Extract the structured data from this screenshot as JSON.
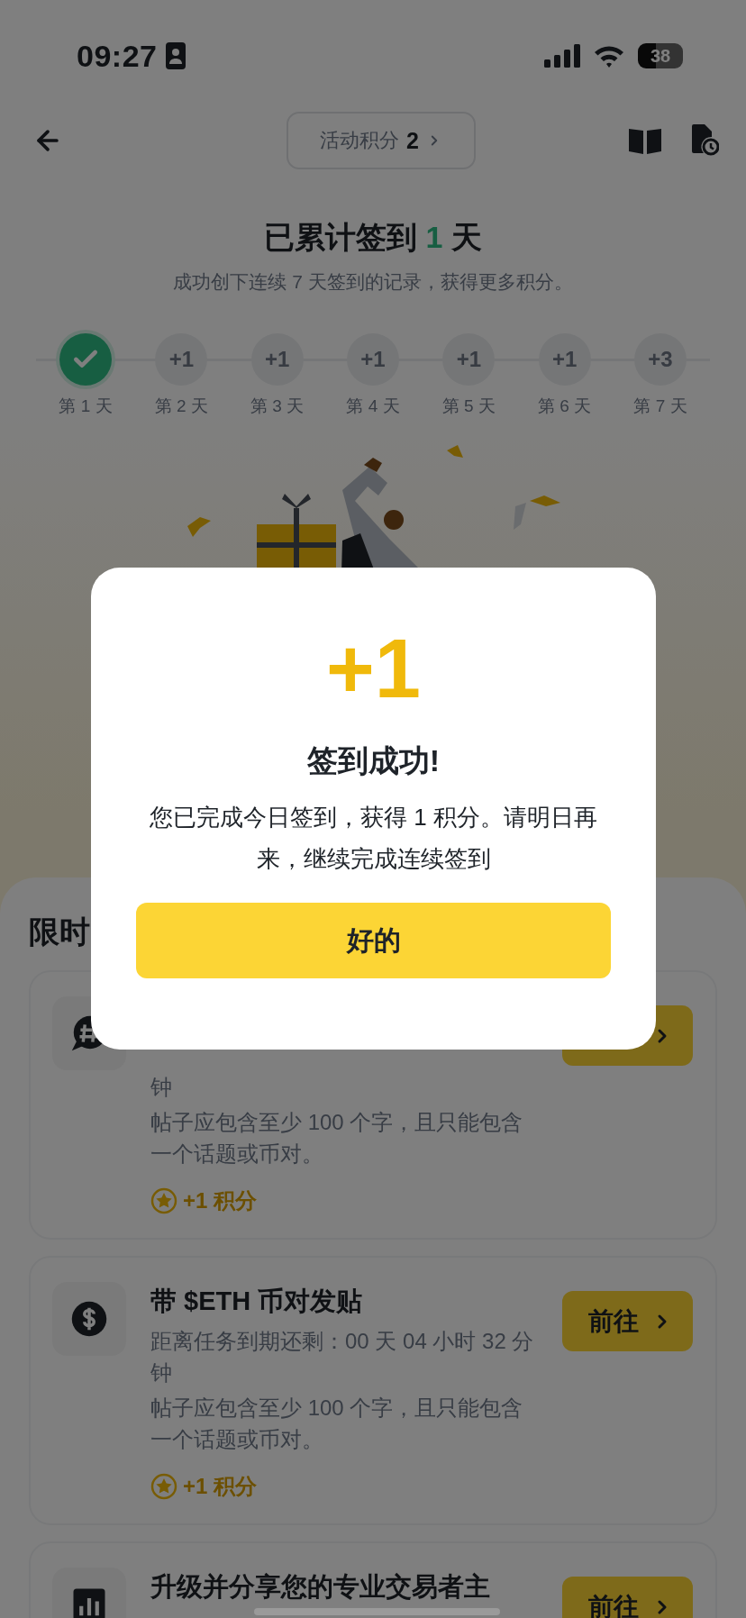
{
  "status_bar": {
    "time": "09:27",
    "battery": "38"
  },
  "header": {
    "points_label": "活动积分",
    "points_value": "2"
  },
  "streak": {
    "before": "已累计签到 ",
    "count": "1",
    "after": " 天",
    "subtitle": "成功创下连续 7 天签到的记录，获得更多积分。"
  },
  "steps": [
    {
      "label": "第 1 天",
      "done": true
    },
    {
      "label": "第 2 天",
      "done": false,
      "reward": "+1"
    },
    {
      "label": "第 3 天",
      "done": false,
      "reward": "+1"
    },
    {
      "label": "第 4 天",
      "done": false,
      "reward": "+1"
    },
    {
      "label": "第 5 天",
      "done": false,
      "reward": "+1"
    },
    {
      "label": "第 6 天",
      "done": false,
      "reward": "+1"
    },
    {
      "label": "第 7 天",
      "done": false,
      "reward": "+3"
    }
  ],
  "tasks_section": {
    "title": "限时"
  },
  "tasks": [
    {
      "kind": "hashtag",
      "countdown": "钟",
      "rule": "帖子应包含至少 100 个字，且只能包含一个话题或币对。",
      "reward": "+1 积分"
    },
    {
      "kind": "dollar",
      "title": "带 $ETH 币对发贴",
      "button": "前往",
      "countdown": "距离任务到期还剩：00 天 04 小时 32 分钟",
      "rule": "帖子应包含至少 100 个字，且只能包含一个话题或币对。",
      "reward": "+1 积分"
    },
    {
      "kind": "chart",
      "title": "升级并分享您的专业交易者主",
      "button": "前往"
    }
  ],
  "dialog": {
    "amount": "+1",
    "title": "签到成功!",
    "message": "您已完成今日签到，获得 1 积分。请明日再来，继续完成连续签到",
    "button": "好的"
  }
}
